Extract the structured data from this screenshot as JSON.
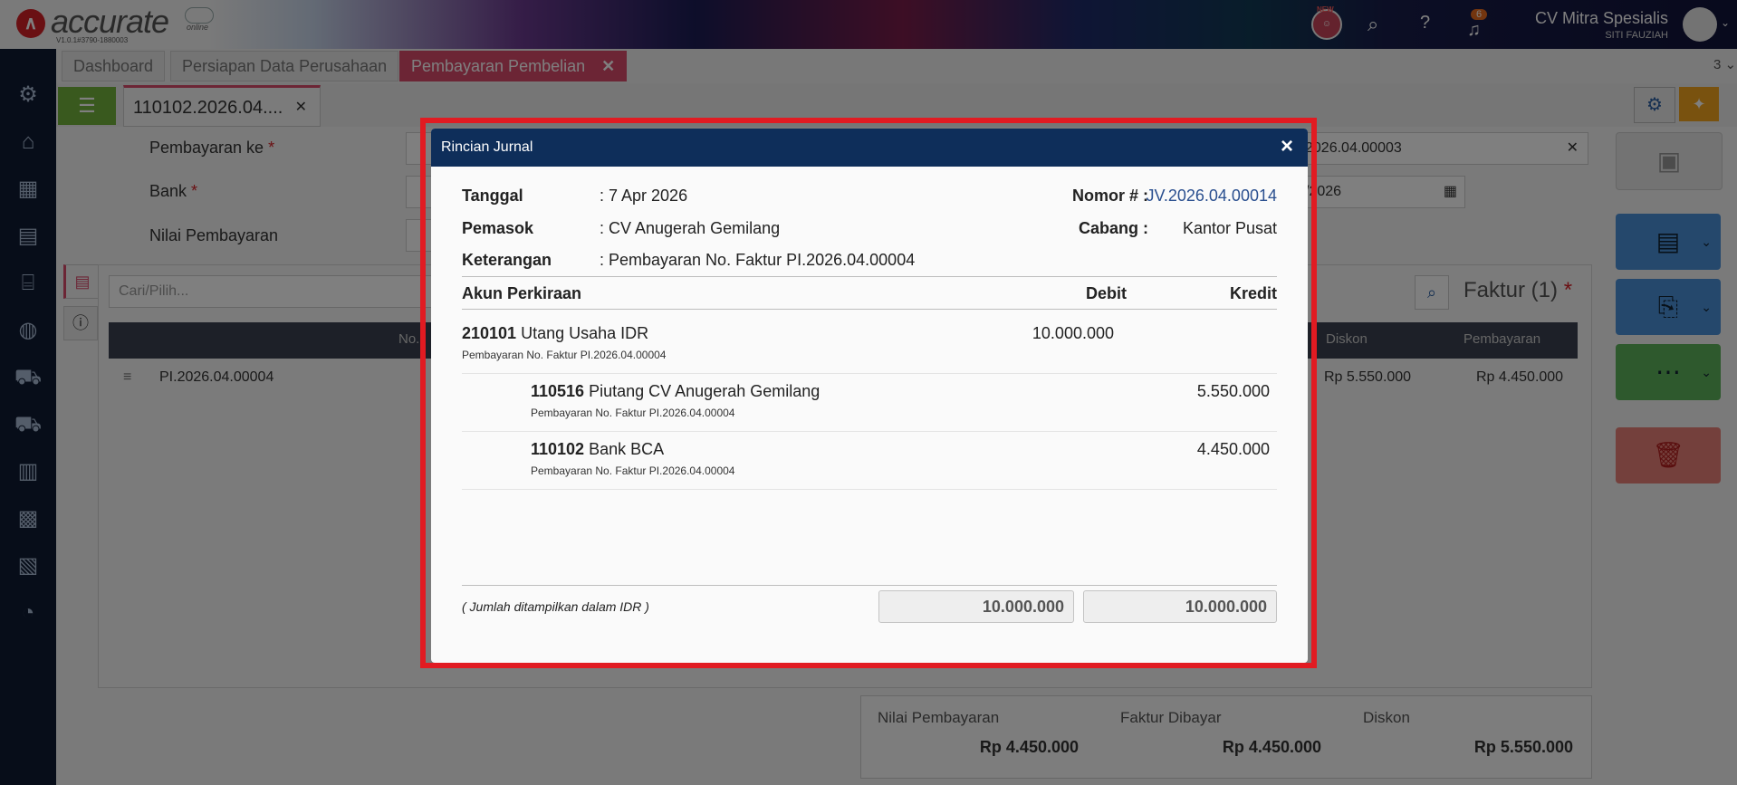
{
  "header": {
    "logo_text": "accurate",
    "logo_sub": "online",
    "version": "V1.0.1#3790-1880003",
    "new_badge": "NEW",
    "notif_count": "6",
    "company": "CV Mitra Spesialis",
    "user": "SITI FAUZIAH"
  },
  "tabs": [
    {
      "label": "Dashboard"
    },
    {
      "label": "Persiapan Data Perusahaan"
    },
    {
      "label": "Pembayaran Pembelian",
      "active": true
    }
  ],
  "tab_count": "3",
  "doc_tab": "110102.2026.04....",
  "form": {
    "pembayaran_ke_label": "Pembayaran ke",
    "bank_label": "Bank",
    "nilai_label": "Nilai Pembayaran",
    "right_number": "2026.04.00003",
    "right_date": "/2026",
    "search_placeholder": "Cari/Pilih..."
  },
  "grid": {
    "title": "Faktur (1)",
    "col_no": "No.",
    "col_diskon": "Diskon",
    "col_pembayaran": "Pembayaran",
    "row_no": "PI.2026.04.00004",
    "row_diskon": "Rp 5.550.000",
    "row_pembayaran": "Rp 4.450.000"
  },
  "summary": {
    "nilai_label": "Nilai Pembayaran",
    "nilai_value": "Rp 4.450.000",
    "faktur_label": "Faktur Dibayar",
    "faktur_value": "Rp 4.450.000",
    "diskon_label": "Diskon",
    "diskon_value": "Rp 5.550.000"
  },
  "modal": {
    "title": "Rincian Jurnal",
    "tanggal_label": "Tanggal",
    "tanggal_value": ": 7 Apr 2026",
    "pemasok_label": "Pemasok",
    "pemasok_value": ": CV Anugerah Gemilang",
    "keterangan_label": "Keterangan",
    "keterangan_value": ": Pembayaran No. Faktur PI.2026.04.00004",
    "nomor_label": "Nomor # :",
    "nomor_value": "JV.2026.04.00014",
    "cabang_label": "Cabang :",
    "cabang_value": "Kantor Pusat",
    "col_akun": "Akun Perkiraan",
    "col_debit": "Debit",
    "col_kredit": "Kredit",
    "entries": [
      {
        "code": "210101",
        "name": "Utang Usaha IDR",
        "note": "Pembayaran No. Faktur PI.2026.04.00004",
        "debit": "10.000.000",
        "kredit": ""
      },
      {
        "code": "110516",
        "name": "Piutang CV Anugerah Gemilang",
        "note": "Pembayaran No. Faktur PI.2026.04.00004",
        "debit": "",
        "kredit": "5.550.000"
      },
      {
        "code": "110102",
        "name": "Bank BCA",
        "note": "Pembayaran No. Faktur PI.2026.04.00004",
        "debit": "",
        "kredit": "4.450.000"
      }
    ],
    "footnote": "( Jumlah ditampilkan dalam IDR )",
    "total_debit": "10.000.000",
    "total_kredit": "10.000.000"
  }
}
